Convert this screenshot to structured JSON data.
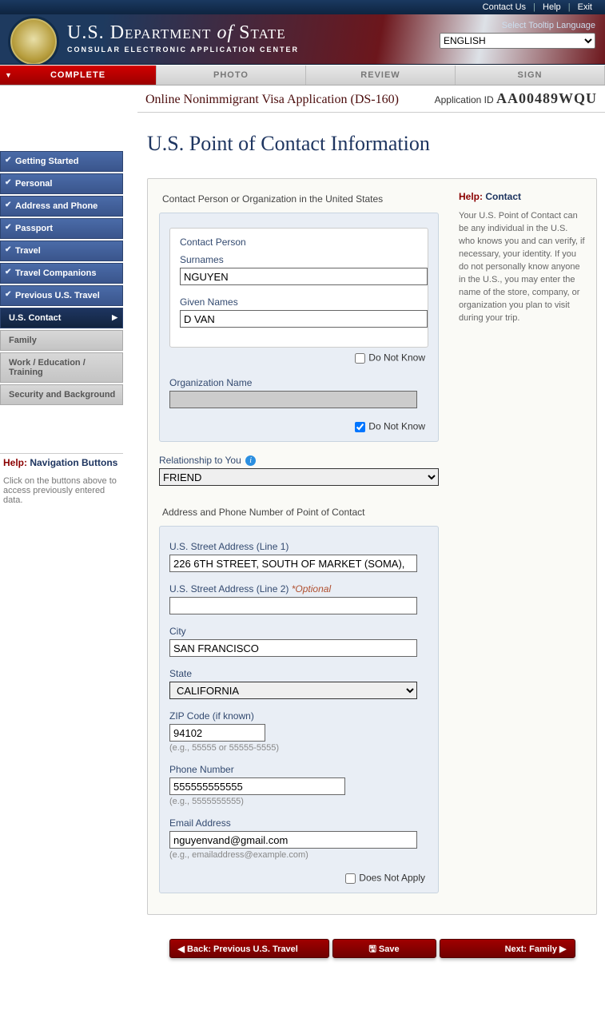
{
  "top_links": {
    "contact": "Contact Us",
    "help": "Help",
    "exit": "Exit"
  },
  "header": {
    "title_prefix": "U.S. ",
    "title_word1": "Department",
    "title_of": " of ",
    "title_word2": "State",
    "subtitle": "CONSULAR ELECTRONIC APPLICATION CENTER",
    "lang_label": "Select Tooltip Language",
    "lang_value": "ENGLISH"
  },
  "tabs": {
    "complete": "COMPLETE",
    "photo": "PHOTO",
    "review": "REVIEW",
    "sign": "SIGN"
  },
  "subhead": {
    "title": "Online Nonimmigrant Visa Application (DS-160)",
    "appid_label": "Application ID ",
    "appid": "AA00489WQU"
  },
  "nav": {
    "items": [
      {
        "label": "Getting Started",
        "state": "done"
      },
      {
        "label": "Personal",
        "state": "done"
      },
      {
        "label": "Address and Phone",
        "state": "done"
      },
      {
        "label": "Passport",
        "state": "done"
      },
      {
        "label": "Travel",
        "state": "done"
      },
      {
        "label": "Travel Companions",
        "state": "done"
      },
      {
        "label": "Previous U.S. Travel",
        "state": "done"
      },
      {
        "label": "U.S. Contact",
        "state": "current"
      },
      {
        "label": "Family",
        "state": "pending"
      },
      {
        "label": "Work / Education / Training",
        "state": "pending"
      },
      {
        "label": "Security and Background",
        "state": "pending"
      }
    ]
  },
  "help_nav": {
    "heading_red": "Help:",
    "heading_blue": "Navigation Buttons",
    "text": "Click on the buttons above to access previously entered data."
  },
  "page": {
    "h1": "U.S. Point of Contact Information",
    "section1": "Contact Person or Organization in the United States",
    "contact_person_legend": "Contact Person",
    "surnames_label": "Surnames",
    "surnames_value": "NGUYEN",
    "given_label": "Given Names",
    "given_value": "D VAN",
    "dnk": "Do Not Know",
    "org_label": "Organization Name",
    "org_value": "",
    "org_dnk_checked": true,
    "rel_label": "Relationship to You",
    "rel_value": "FRIEND",
    "section2": "Address and Phone Number of Point of Contact",
    "addr1_label": "U.S. Street Address (Line 1)",
    "addr1_value": "226 6TH STREET, SOUTH OF MARKET (SOMA),",
    "addr2_label": "U.S. Street Address (Line 2) ",
    "addr2_opt": "*Optional",
    "addr2_value": "",
    "city_label": "City",
    "city_value": "SAN FRANCISCO",
    "state_label": "State",
    "state_value": "CALIFORNIA",
    "zip_label": "ZIP Code (if known)",
    "zip_value": "94102",
    "zip_hint": "(e.g., 55555 or 55555-5555)",
    "phone_label": "Phone Number",
    "phone_value": "555555555555",
    "phone_hint": "(e.g., 5555555555)",
    "email_label": "Email Address",
    "email_value": "nguyenvand@gmail.com",
    "email_hint": "(e.g., emailaddress@example.com)",
    "dna": "Does Not Apply"
  },
  "help_contact": {
    "heading_red": "Help:",
    "heading_blue": "Contact",
    "text": "Your U.S. Point of Contact can be any individual in the U.S. who knows you and can verify, if necessary, your identity. If you do not personally know anyone in the U.S., you may enter the name of the store, company, or organization you plan to visit during your trip."
  },
  "footer": {
    "back": "◀ Back: Previous U.S. Travel",
    "save": "🖫 Save",
    "next": "Next: Family ▶"
  }
}
